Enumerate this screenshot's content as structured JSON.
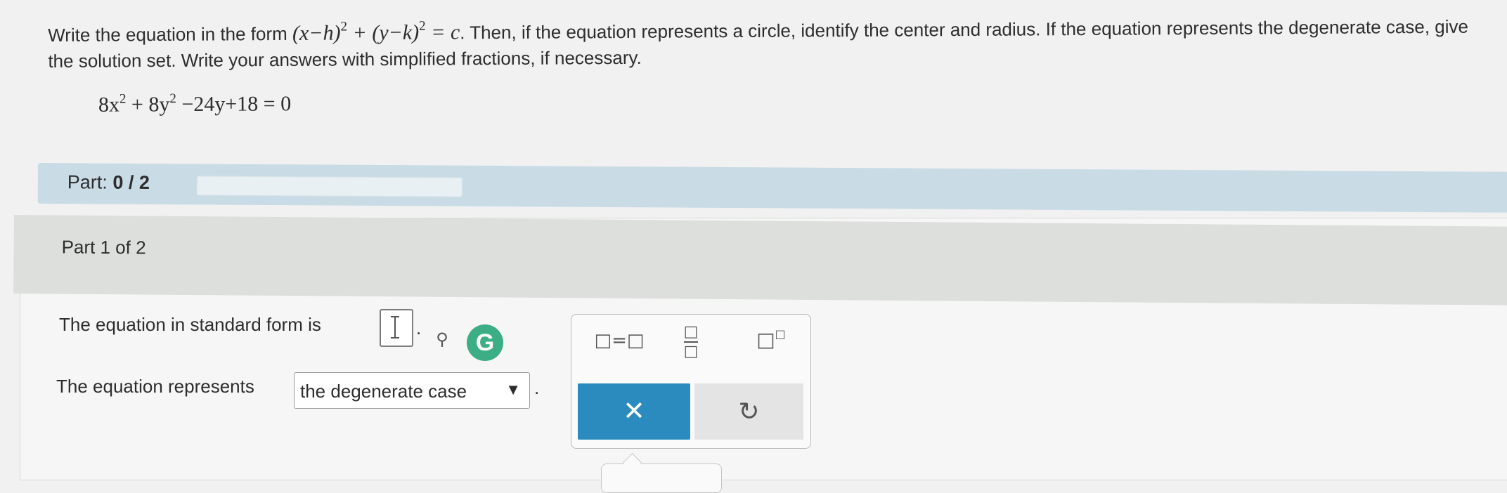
{
  "question": {
    "prefix": "Write the equation in the form",
    "form_h": "(x−h)",
    "form_k": "(y−k)",
    "exp": "2",
    "form_c": "= c",
    "suffix": ". Then, if the equation represents a circle, identify the center and radius. If the equation represents the degenerate case, give the solution set. Write your answers with simplified fractions, if necessary."
  },
  "equation": {
    "a": "8x",
    "b": "8y",
    "exp": "2",
    "rest": "−24y+18 = 0"
  },
  "progress": {
    "label": "Part:",
    "value": "0 / 2",
    "fraction": 0
  },
  "part_header": "Part 1 of 2",
  "standard_form": {
    "label": "The equation in standard form is",
    "period": "."
  },
  "represents": {
    "label": "The equation represents",
    "selected": "the degenerate case",
    "arrow": "▼",
    "period": "."
  },
  "toolbar": {
    "equals_tool": "□=□",
    "frac_box": "□",
    "power_base": "□",
    "power_exp": "□",
    "clear": "✕",
    "undo": "↻",
    "grammarly": "G"
  }
}
